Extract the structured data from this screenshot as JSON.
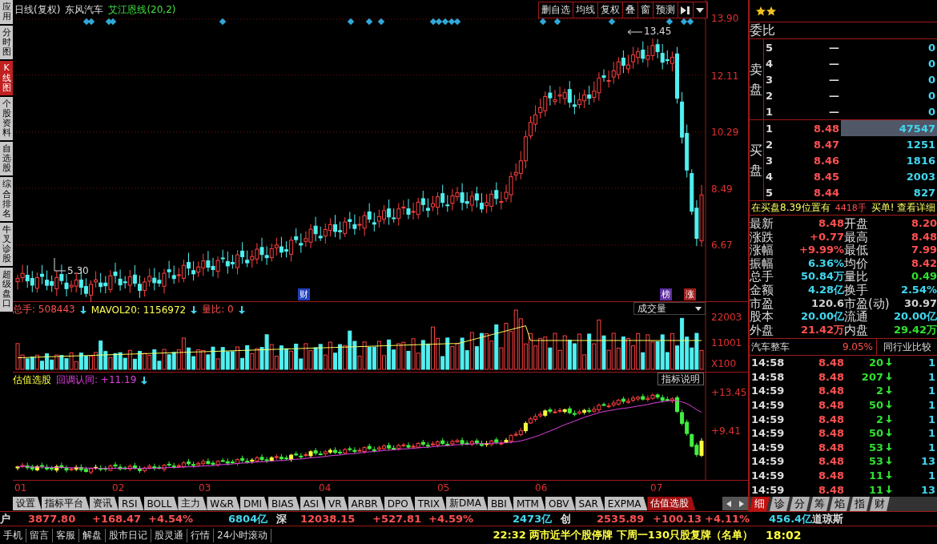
{
  "side_tabs": [
    {
      "label": "应用",
      "selected": false
    },
    {
      "label": "分时图",
      "selected": false
    },
    {
      "label": "K线图",
      "selected": true
    },
    {
      "label": "个股资料",
      "selected": false
    },
    {
      "label": "自选股",
      "selected": false
    },
    {
      "label": "综合排名",
      "selected": false
    },
    {
      "label": "牛叉诊股",
      "selected": false
    },
    {
      "label": "超级盘口",
      "selected": false
    }
  ],
  "price_panel": {
    "period": "日线(复权)",
    "stock": "东风汽车",
    "indicator": "艾江恩线(20,2)",
    "toolbar": [
      "删自选",
      "均线",
      "复权",
      "叠",
      "窗",
      "预测"
    ],
    "axis": [
      "13.90",
      "12.11",
      "10.29",
      "8.49",
      "6.67"
    ],
    "high_label": "13.45",
    "low_label": "5.30",
    "markers": [
      {
        "text": "财",
        "color": "#2040c0"
      },
      {
        "text": "榜",
        "color": "#6030a0"
      },
      {
        "text": "涨",
        "color": "#a02020"
      }
    ]
  },
  "volume_panel": {
    "readouts": [
      {
        "text": "总手: 508443",
        "color": "#ff5050"
      },
      {
        "text": "MAVOL20: 1156972",
        "color": "#ffff50"
      },
      {
        "text": "量比: 0",
        "color": "#ff5050"
      }
    ],
    "selector": "成交量",
    "axis": [
      "22003",
      "11001",
      "X100"
    ]
  },
  "indicator_panel": {
    "name": "估值选股",
    "readout": "回调认同: +11.19",
    "button": "指标说明",
    "axis": [
      "+13.45",
      "+9.41"
    ]
  },
  "x_axis": [
    "01",
    "02",
    "03",
    "04",
    "05",
    "06",
    "07"
  ],
  "indicator_tabs": [
    {
      "label": "设置",
      "selected": false
    },
    {
      "label": "指标平台",
      "selected": false
    },
    {
      "label": "资讯",
      "selected": false
    },
    {
      "label": "RSI",
      "selected": false
    },
    {
      "label": "BOLL",
      "selected": false
    },
    {
      "label": "主力",
      "selected": false
    },
    {
      "label": "W&R",
      "selected": false
    },
    {
      "label": "DMI",
      "selected": false
    },
    {
      "label": "BIAS",
      "selected": false
    },
    {
      "label": "ASI",
      "selected": false
    },
    {
      "label": "VR",
      "selected": false
    },
    {
      "label": "ARBR",
      "selected": false
    },
    {
      "label": "DPO",
      "selected": false
    },
    {
      "label": "TRIX",
      "selected": false
    },
    {
      "label": "新DMA",
      "selected": false
    },
    {
      "label": "BBI",
      "selected": false
    },
    {
      "label": "MTM",
      "selected": false
    },
    {
      "label": "OBV",
      "selected": false
    },
    {
      "label": "SAR",
      "selected": false
    },
    {
      "label": "EXPMA",
      "selected": false
    },
    {
      "label": "估值选股",
      "selected": true
    }
  ],
  "order_book": {
    "title": "委比",
    "sell_label": "卖盘",
    "buy_label": "买盘",
    "sell": [
      {
        "level": "5",
        "price": "—",
        "volume": "0"
      },
      {
        "level": "4",
        "price": "—",
        "volume": "0"
      },
      {
        "level": "3",
        "price": "—",
        "volume": "0"
      },
      {
        "level": "2",
        "price": "—",
        "volume": "0"
      },
      {
        "level": "1",
        "price": "—",
        "volume": "0"
      }
    ],
    "buy": [
      {
        "level": "1",
        "price": "8.48",
        "volume": "47547",
        "selected": true
      },
      {
        "level": "2",
        "price": "8.47",
        "volume": "1251",
        "selected": false
      },
      {
        "level": "3",
        "price": "8.46",
        "volume": "1816",
        "selected": false
      },
      {
        "level": "4",
        "price": "8.45",
        "volume": "2003",
        "selected": false
      },
      {
        "level": "5",
        "price": "8.44",
        "volume": "827",
        "selected": false
      }
    ]
  },
  "notice": {
    "text": "在买盘8.39位置有",
    "amount": "4418手",
    "link": "买单! 查看详细"
  },
  "stats": [
    [
      {
        "label": "最新",
        "value": "8.48",
        "color": "#ff5050"
      },
      {
        "label": "开盘",
        "value": "8.20",
        "color": "#ff5050"
      }
    ],
    [
      {
        "label": "涨跌",
        "value": "+0.77",
        "color": "#ff5050"
      },
      {
        "label": "最高",
        "value": "8.48",
        "color": "#ff5050"
      }
    ],
    [
      {
        "label": "涨幅",
        "value": "+9.99%",
        "color": "#ff5050"
      },
      {
        "label": "最低",
        "value": "7.99",
        "color": "#ff5050"
      }
    ],
    [
      {
        "label": "振幅",
        "value": "6.36%",
        "color": "#40d8f0"
      },
      {
        "label": "均价",
        "value": "8.42",
        "color": "#ff5050"
      }
    ],
    [
      {
        "label": "总手",
        "value": "50.84万",
        "color": "#40d8f0"
      },
      {
        "label": "量比",
        "value": "0.49",
        "color": "#30e030"
      }
    ],
    [
      {
        "label": "金额",
        "value": "4.28亿",
        "color": "#40d8f0"
      },
      {
        "label": "换手",
        "value": "2.54%",
        "color": "#40d8f0"
      }
    ],
    [
      {
        "label": "市盈",
        "value": "120.6",
        "color": "#d0d0d0"
      },
      {
        "label": "市盈(动)",
        "value": "30.97",
        "color": "#d0d0d0"
      }
    ],
    [
      {
        "label": "股本",
        "value": "20.00亿",
        "color": "#40d8f0"
      },
      {
        "label": "流通",
        "value": "20.00亿",
        "color": "#40d8f0"
      }
    ],
    [
      {
        "label": "外盘",
        "value": "21.42万",
        "color": "#ff5050"
      },
      {
        "label": "内盘",
        "value": "29.42万",
        "color": "#30e030"
      }
    ]
  ],
  "industry": {
    "name": "汽车整车",
    "change": "9.05%",
    "button": "同行业比较"
  },
  "trades": [
    {
      "time": "14:58",
      "price": "8.48",
      "volume": "20",
      "column_4": "1"
    },
    {
      "time": "14:58",
      "price": "8.48",
      "volume": "207",
      "column_4": "1"
    },
    {
      "time": "14:59",
      "price": "8.48",
      "volume": "2",
      "column_4": "1"
    },
    {
      "time": "14:59",
      "price": "8.48",
      "volume": "50",
      "column_4": "1"
    },
    {
      "time": "14:59",
      "price": "8.48",
      "volume": "2",
      "column_4": "1"
    },
    {
      "time": "14:59",
      "price": "8.48",
      "volume": "50",
      "column_4": "1"
    },
    {
      "time": "14:59",
      "price": "8.48",
      "volume": "53",
      "column_4": "1"
    },
    {
      "time": "14:59",
      "price": "8.48",
      "volume": "53",
      "column_4": "13"
    },
    {
      "time": "14:59",
      "price": "8.48",
      "volume": "11",
      "column_4": "1"
    },
    {
      "time": "14:59",
      "price": "8.48",
      "volume": "11",
      "column_4": "13"
    }
  ],
  "detail_tabs": [
    {
      "label": "细",
      "selected": true
    },
    {
      "label": "诊",
      "selected": false
    },
    {
      "label": "分",
      "selected": false
    },
    {
      "label": "筹",
      "selected": false
    },
    {
      "label": "焰",
      "selected": false
    },
    {
      "label": "指",
      "selected": false
    },
    {
      "label": "财",
      "selected": false
    }
  ],
  "index_row": [
    {
      "text": "户",
      "kind": "name"
    },
    {
      "text": "3877.80",
      "kind": "rise"
    },
    {
      "text": "+168.47",
      "kind": "rise"
    },
    {
      "text": "+4.54%",
      "kind": "rise"
    },
    {
      "text": "6804亿",
      "kind": "amount"
    },
    {
      "text": "深",
      "kind": "name"
    },
    {
      "text": "12038.15",
      "kind": "rise"
    },
    {
      "text": "+527.81",
      "kind": "rise"
    },
    {
      "text": "+4.59%",
      "kind": "rise"
    },
    {
      "text": "2473亿",
      "kind": "amount"
    },
    {
      "text": "创",
      "kind": "name"
    },
    {
      "text": "2535.89",
      "kind": "rise"
    },
    {
      "text": "+100.13",
      "kind": "rise"
    },
    {
      "text": "+4.11%",
      "kind": "rise"
    },
    {
      "text": "456.4亿",
      "kind": "amount"
    },
    {
      "text": "道琼斯",
      "kind": "name"
    }
  ],
  "bottom_links": [
    "手机",
    "留言",
    "客服",
    "解盘",
    "股市日记",
    "股灵通",
    "行情",
    "24小时滚动"
  ],
  "news": "22:32 两市近半个股停牌 下周一130只股复牌（名单）",
  "clock": "18:02"
}
